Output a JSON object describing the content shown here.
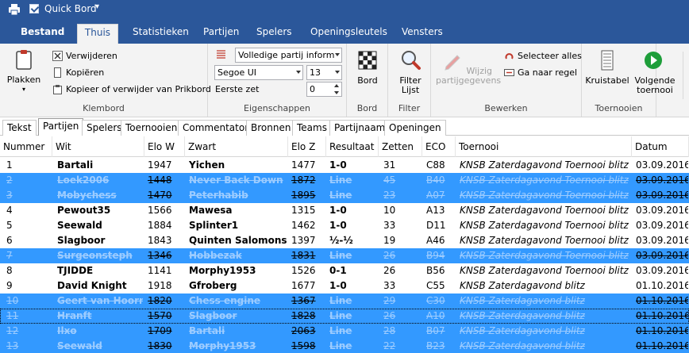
{
  "titlebar": {
    "title": "Quick Bord",
    "dropdown": "▾"
  },
  "ribbon_tabs": [
    "Bestand",
    "Thuis",
    "Statistieken",
    "Partijen",
    "Spelers",
    "Openingsleutels",
    "Vensters"
  ],
  "klembord": {
    "paste": "Plakken",
    "delete": "Verwijderen",
    "copy": "Kopiëren",
    "copy_or_delete": "Kopieer of verwijder van Prikbord",
    "label": "Klembord"
  },
  "eigenschappen": {
    "notation_combo": "Volledige partij inform",
    "font_combo": "Segoe UI",
    "size_combo": "13",
    "first_move_label": "Eerste zet",
    "first_move_value": "0",
    "label": "Eigenschappen"
  },
  "bord": {
    "button": "Bord",
    "label": "Bord"
  },
  "filter": {
    "button": "Filter Lijst",
    "label": "Filter"
  },
  "bewerken": {
    "edit": "Wijzig partijgegevens",
    "select_all": "Selecteer alles",
    "goto_line": "Ga naar regel",
    "label": "Bewerken"
  },
  "toernooien": {
    "crosstable": "Kruistabel",
    "next": "Volgende toernooi",
    "label": "Toernooien"
  },
  "content_tabs": [
    "Tekst",
    "Partijen",
    "Spelers",
    "Toernooien",
    "Commentator",
    "Bronnen",
    "Teams",
    "Partijnaam",
    "Openingen"
  ],
  "columns": [
    "Nummer",
    "Wit",
    "Elo W",
    "Zwart",
    "Elo Z",
    "Resultaat",
    "Zetten",
    "ECO",
    "Toernooi",
    "Datum"
  ],
  "rows": [
    [
      "1",
      "Bartali",
      "1947",
      "Yichen",
      "1477",
      "1-0",
      "31",
      "C88",
      "KNSB Zaterdagavond Toernooi blitz",
      "03.09.2016"
    ],
    [
      "2",
      "Loek2006",
      "1448",
      "Never Back Down",
      "1872",
      "Line",
      "45",
      "B40",
      "KNSB Zaterdagavond Toernooi blitz",
      "03.09.2016"
    ],
    [
      "3",
      "Mobychess",
      "1470",
      "Peterhabib",
      "1895",
      "Line",
      "23",
      "A07",
      "KNSB Zaterdagavond Toernooi blitz",
      "03.09.2016"
    ],
    [
      "4",
      "Pewout35",
      "1566",
      "Mawesa",
      "1315",
      "1-0",
      "10",
      "A13",
      "KNSB Zaterdagavond Toernooi blitz",
      "03.09.2016"
    ],
    [
      "5",
      "Seewald",
      "1884",
      "Splinter1",
      "1462",
      "1-0",
      "33",
      "D11",
      "KNSB Zaterdagavond Toernooi blitz",
      "03.09.2016"
    ],
    [
      "6",
      "Slagboor",
      "1843",
      "Quinten Salomons",
      "1397",
      "½-½",
      "19",
      "A46",
      "KNSB Zaterdagavond Toernooi blitz",
      "03.09.2016"
    ],
    [
      "7",
      "Surgeonsteph",
      "1346",
      "Hobbezak",
      "1831",
      "Line",
      "26",
      "B94",
      "KNSB Zaterdagavond Toernooi blitz",
      "03.09.2016"
    ],
    [
      "8",
      "TJIDDE",
      "1141",
      "Morphy1953",
      "1526",
      "0-1",
      "26",
      "B56",
      "KNSB Zaterdagavond Toernooi blitz",
      "03.09.2016"
    ],
    [
      "9",
      "David Knight",
      "1918",
      "Gfroberg",
      "1677",
      "1-0",
      "33",
      "C55",
      "KNSB Zaterdagavond blitz",
      "01.10.2016"
    ],
    [
      "10",
      "Geert van Hoorn",
      "1820",
      "Chess engine",
      "1367",
      "Line",
      "29",
      "C30",
      "KNSB Zaterdagavond blitz",
      "01.10.2016"
    ],
    [
      "11",
      "Hranft",
      "1570",
      "Slagboor",
      "1828",
      "Line",
      "26",
      "A10",
      "KNSB Zaterdagavond blitz",
      "01.10.2016"
    ],
    [
      "12",
      "Ilxo",
      "1709",
      "Bartali",
      "2063",
      "Line",
      "28",
      "B07",
      "KNSB Zaterdagavond blitz",
      "01.10.2016"
    ],
    [
      "13",
      "Seewald",
      "1830",
      "Morphy1953",
      "1598",
      "Line",
      "22",
      "B23",
      "KNSB Zaterdagavond blitz",
      "01.10.2016"
    ]
  ],
  "colors": {
    "accent": "#2b579a",
    "selection": "#3399ff"
  }
}
